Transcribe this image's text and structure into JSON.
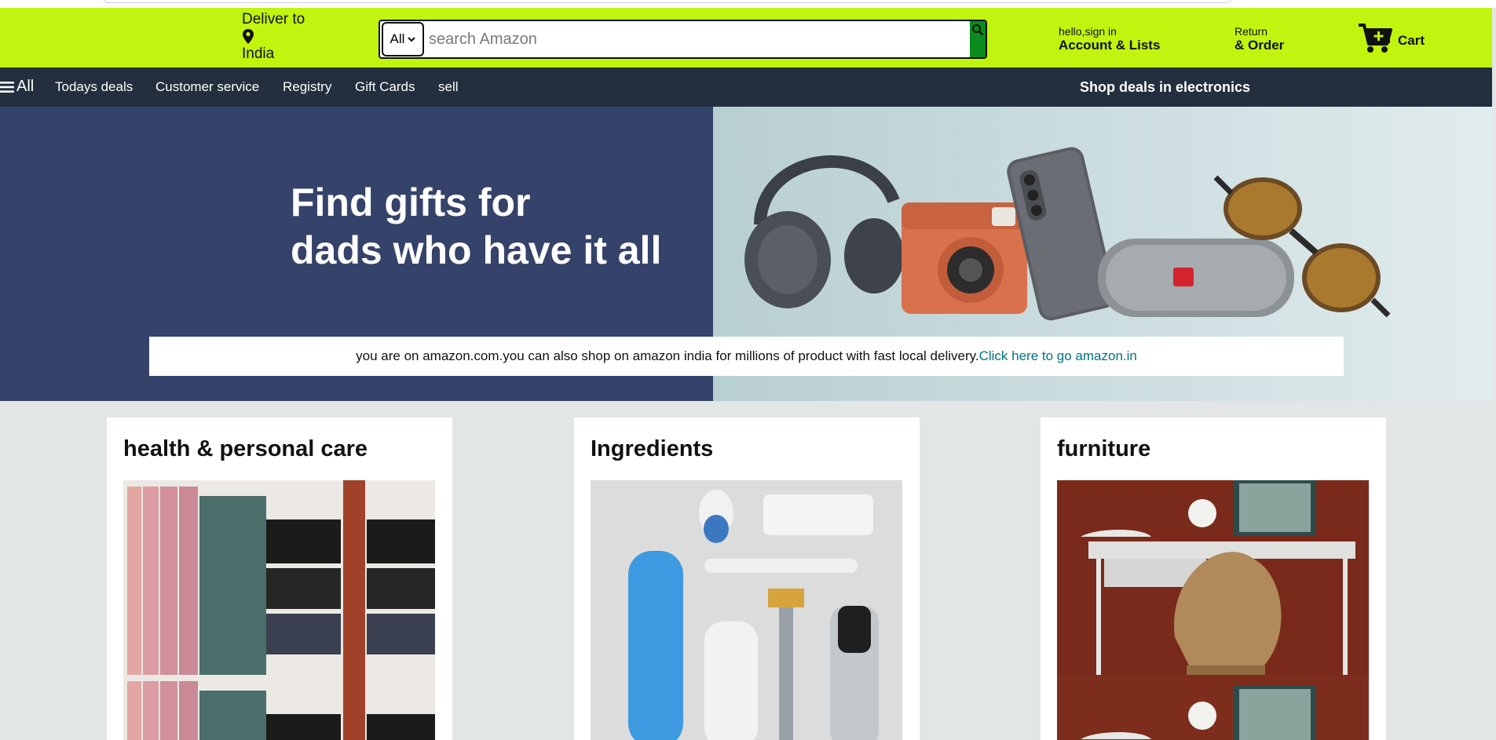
{
  "header": {
    "deliver_label": "Deliver to",
    "deliver_location": "India",
    "search": {
      "category": "All",
      "placeholder": "search Amazon"
    },
    "account": {
      "greeting": "hello,sign in",
      "label": "Account & Lists"
    },
    "orders": {
      "top": "Return",
      "bottom": "& Order"
    },
    "cart_label": "Cart"
  },
  "nav": {
    "all_label": "All",
    "items": [
      "Todays deals",
      "Customer service",
      "Registry",
      "Gift Cards",
      "sell"
    ],
    "promo": "Shop deals in electronics"
  },
  "hero": {
    "title_line1": "Find gifts for",
    "title_line2": "dads who have it all",
    "notice_text": "you are on amazon.com.you can also shop on amazon india for millions of product with fast local delivery.",
    "notice_link": "Click here to go amazon.in"
  },
  "cards": [
    {
      "title": "health & personal care"
    },
    {
      "title": "Ingredients"
    },
    {
      "title": "furniture"
    }
  ],
  "colors": {
    "header_bg": "#c1f40f",
    "nav_bg": "#232f3e",
    "hero_left_bg": "#354269",
    "search_button": "#0a8a1c",
    "link": "#007185",
    "page_bg": "#e3e6e6"
  }
}
